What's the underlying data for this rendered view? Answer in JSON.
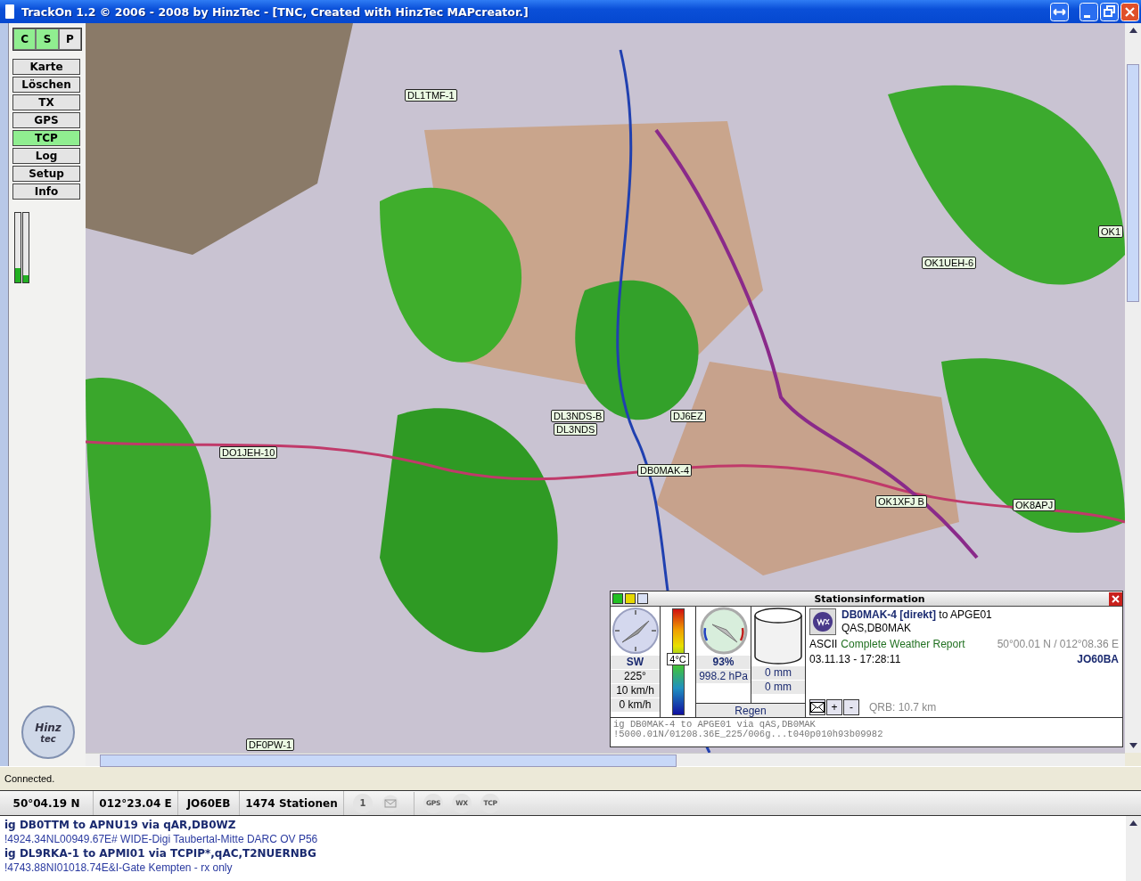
{
  "window": {
    "title": "TrackOn 1.2 © 2006 - 2008 by HinzTec - [TNC, Created with HinzTec MAPcreator.]"
  },
  "sidebar": {
    "mode_buttons": [
      {
        "label": "C",
        "selected": true
      },
      {
        "label": "S",
        "selected": true
      },
      {
        "label": "P",
        "selected": false
      }
    ],
    "buttons": [
      {
        "label": "Karte",
        "selected": false
      },
      {
        "label": "Löschen",
        "selected": false
      },
      {
        "label": "TX",
        "selected": false
      },
      {
        "label": "GPS",
        "selected": false
      },
      {
        "label": "TCP",
        "selected": true
      },
      {
        "label": "Log",
        "selected": false
      },
      {
        "label": "Setup",
        "selected": false
      },
      {
        "label": "Info",
        "selected": false
      }
    ],
    "meters": [
      {
        "level": 0.2
      },
      {
        "level": 0.1
      }
    ],
    "logo": {
      "line1": "Hinz",
      "line2": "tec"
    }
  },
  "map": {
    "kind": "picture",
    "stations": [
      {
        "callsign": "DL1TMF-1"
      },
      {
        "callsign": "OK1"
      },
      {
        "callsign": "OK1UEH-6"
      },
      {
        "callsign": "DL3NDS-B"
      },
      {
        "callsign": "DJ6EZ"
      },
      {
        "callsign": "DL3NDS"
      },
      {
        "callsign": "DO1JEH-10"
      },
      {
        "callsign": "DB0MAK-4"
      },
      {
        "callsign": "OK1XFJ B"
      },
      {
        "callsign": "OK8APJ"
      },
      {
        "callsign": "DF0PW-1"
      }
    ]
  },
  "station_info": {
    "title": "Stationsinformation",
    "weather": {
      "direction": "SW",
      "degrees": "225°",
      "wind_speed": "10 km/h",
      "gust": "0 km/h",
      "temperature": "4°C",
      "humidity": "93%",
      "pressure": "998.2 hPa",
      "rain_1": "0 mm",
      "rain_2": "0 mm",
      "rain_label": "Regen"
    },
    "callsign": "DB0MAK-4 [direkt]",
    "destination": "to APGE01",
    "path": "QAS,DB0MAK",
    "format": "ASCII",
    "comment": "Complete Weather Report",
    "position": "50°00.01 N / 012°08.36 E",
    "time": "03.11.13 - 17:28:11",
    "locator": "JO60BA",
    "zoom_in": "+",
    "zoom_out": "-",
    "qrb": "QRB: 10.7 km",
    "raw": [
      "ig DB0MAK-4 to APGE01 via qAS,DB0MAK",
      "!5000.01N/01208.36E_225/006g...t040p010h93b09982"
    ]
  },
  "status": "Connected.",
  "info_bar": {
    "latitude": "50°04.19 N",
    "longitude": "012°23.04 E",
    "locator": "JO60EB",
    "stations": "1474 Stationen",
    "indicators": [
      {
        "kind": "text",
        "label": "1",
        "on": false
      },
      {
        "kind": "mail",
        "on": false
      },
      {
        "kind": "text",
        "label": "GPS",
        "on": false
      },
      {
        "kind": "text",
        "label": "WX",
        "on": false
      },
      {
        "kind": "text",
        "label": "TCP",
        "on": false
      }
    ]
  },
  "log": [
    {
      "kind": "header",
      "text": "ig DB0TTM to APNU19 via qAR,DB0WZ"
    },
    {
      "kind": "data",
      "text": "!4924.34NL00949.67E# WIDE-Digi  Taubertal-Mitte   DARC OV P56"
    },
    {
      "kind": "header",
      "text": "ig DL9RKA-1 to APMI01 via TCPIP*,qAC,T2NUERNBG"
    },
    {
      "kind": "data",
      "text": "!4743.88NI01018.74E&I-Gate Kempten - rx only"
    }
  ]
}
